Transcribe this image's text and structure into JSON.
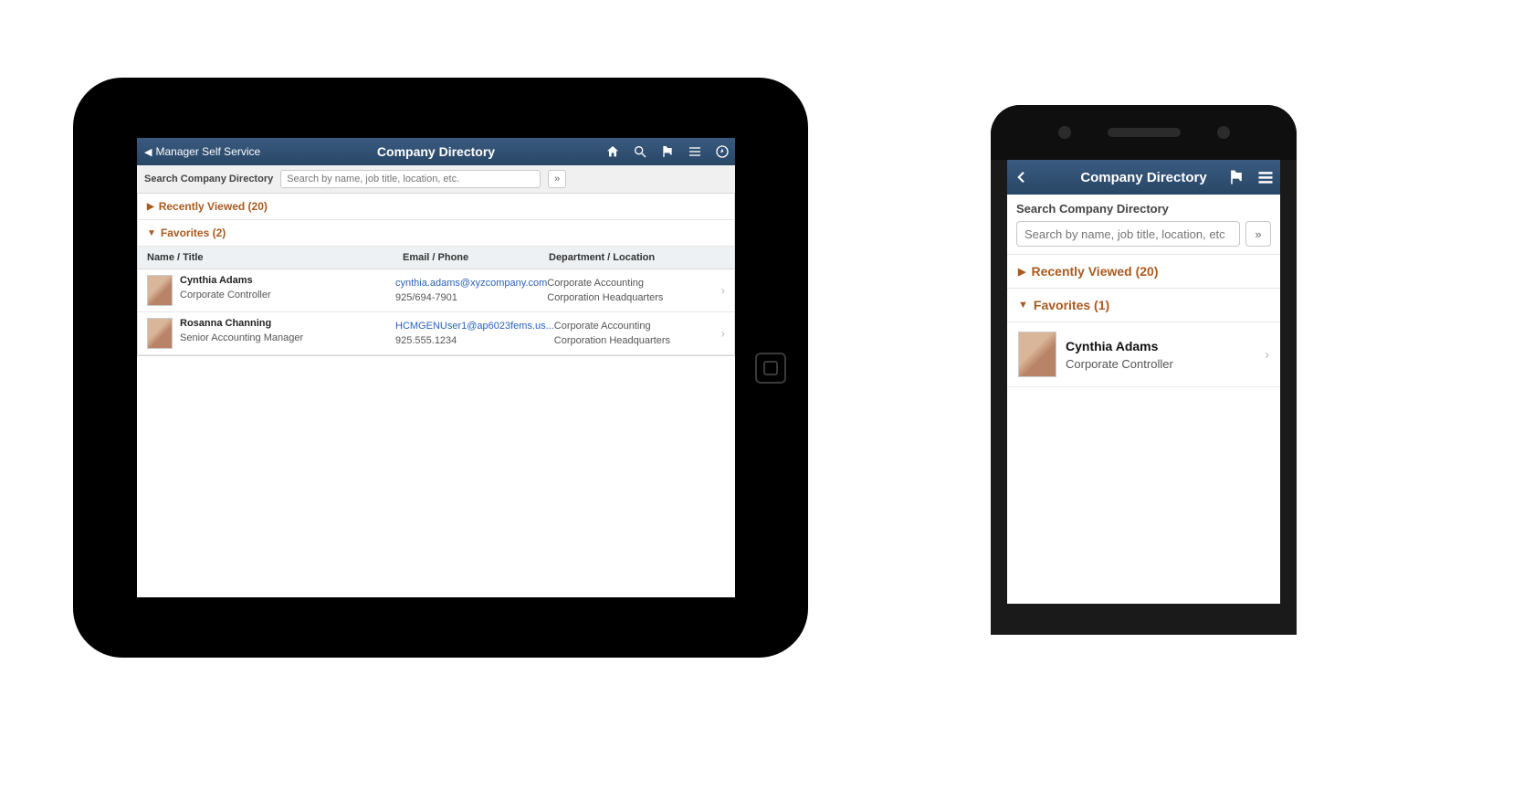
{
  "tablet": {
    "back_label": "Manager Self Service",
    "title": "Company Directory",
    "search_label": "Search Company Directory",
    "search_placeholder": "Search by name, job title, location, etc.",
    "search_go": "»",
    "recently_viewed_label": "Recently Viewed (20)",
    "favorites_label": "Favorites (2)",
    "col1": "Name / Title",
    "col2": "Email / Phone",
    "col3": "Department / Location",
    "rows": [
      {
        "name": "Cynthia Adams",
        "title": "Corporate Controller",
        "email": "cynthia.adams@xyzcompany.com",
        "phone": "925/694-7901",
        "dept": "Corporate Accounting",
        "loc": "Corporation Headquarters"
      },
      {
        "name": "Rosanna Channing",
        "title": "Senior Accounting Manager",
        "email": "HCMGENUser1@ap6023fems.us...",
        "phone": "925.555.1234",
        "dept": "Corporate Accounting",
        "loc": "Corporation Headquarters"
      }
    ]
  },
  "phone": {
    "title": "Company Directory",
    "search_label": "Search Company Directory",
    "search_placeholder": "Search by name, job title, location, etc",
    "search_go": "»",
    "recently_viewed_label": "Recently Viewed (20)",
    "favorites_label": "Favorites (1)",
    "rows": [
      {
        "name": "Cynthia Adams",
        "title": "Corporate Controller"
      }
    ]
  }
}
